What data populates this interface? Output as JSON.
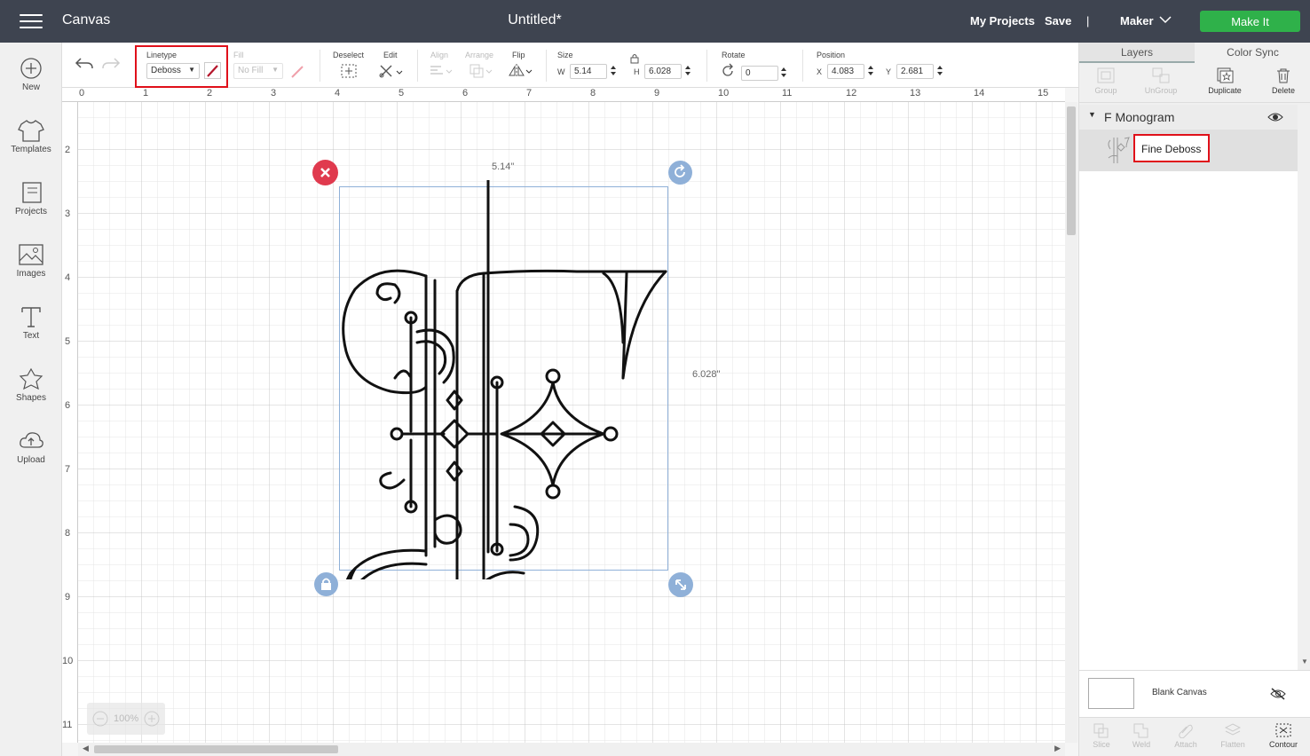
{
  "app": {
    "title": "Canvas",
    "doc_title": "Untitled*"
  },
  "topnav": {
    "my_projects": "My Projects",
    "save": "Save",
    "divider": "|",
    "machine": "Maker",
    "make_it": "Make It"
  },
  "toolbar": {
    "linetype_label": "Linetype",
    "linetype_value": "Deboss",
    "fill_label": "Fill",
    "fill_value": "No Fill",
    "deselect_label": "Deselect",
    "edit_label": "Edit",
    "align_label": "Align",
    "arrange_label": "Arrange",
    "flip_label": "Flip",
    "size_label": "Size",
    "w_label": "W",
    "w_value": "5.14",
    "h_label": "H",
    "h_value": "6.028",
    "rotate_label": "Rotate",
    "rotate_value": "0",
    "position_label": "Position",
    "x_label": "X",
    "x_value": "4.083",
    "y_label": "Y",
    "y_value": "2.681"
  },
  "sidebar": {
    "items": [
      {
        "label": "New",
        "icon": "plus-circle-icon"
      },
      {
        "label": "Templates",
        "icon": "tshirt-icon"
      },
      {
        "label": "Projects",
        "icon": "projects-icon"
      },
      {
        "label": "Images",
        "icon": "image-icon"
      },
      {
        "label": "Text",
        "icon": "text-icon"
      },
      {
        "label": "Shapes",
        "icon": "shapes-icon"
      },
      {
        "label": "Upload",
        "icon": "cloud-upload-icon"
      }
    ]
  },
  "rulers": {
    "top": [
      "0",
      "1",
      "2",
      "3",
      "4",
      "5",
      "6",
      "7",
      "8",
      "9",
      "10",
      "11",
      "12",
      "13",
      "14",
      "15"
    ],
    "left": [
      "2",
      "3",
      "4",
      "5",
      "6",
      "7",
      "8",
      "9",
      "10",
      "11"
    ]
  },
  "canvas": {
    "width_label": "5.14\"",
    "height_label": "6.028\"",
    "zoom": "100%"
  },
  "panel": {
    "tabs": [
      "Layers",
      "Color Sync"
    ],
    "tools": [
      {
        "label": "Group",
        "enabled": false
      },
      {
        "label": "UnGroup",
        "enabled": false
      },
      {
        "label": "Duplicate",
        "enabled": true
      },
      {
        "label": "Delete",
        "enabled": true
      }
    ],
    "group_name": "F Monogram",
    "layer_name": "Fine Deboss",
    "blank_canvas": "Blank Canvas",
    "bottom_tools": [
      {
        "label": "Slice",
        "enabled": false
      },
      {
        "label": "Weld",
        "enabled": false
      },
      {
        "label": "Attach",
        "enabled": false
      },
      {
        "label": "Flatten",
        "enabled": false
      },
      {
        "label": "Contour",
        "enabled": true
      }
    ]
  },
  "colors": {
    "topbar": "#3e4450",
    "make_it": "#2fb14a",
    "highlight": "#e0101a",
    "selection": "#8fb0d8",
    "delete_handle": "#e03a4e"
  }
}
